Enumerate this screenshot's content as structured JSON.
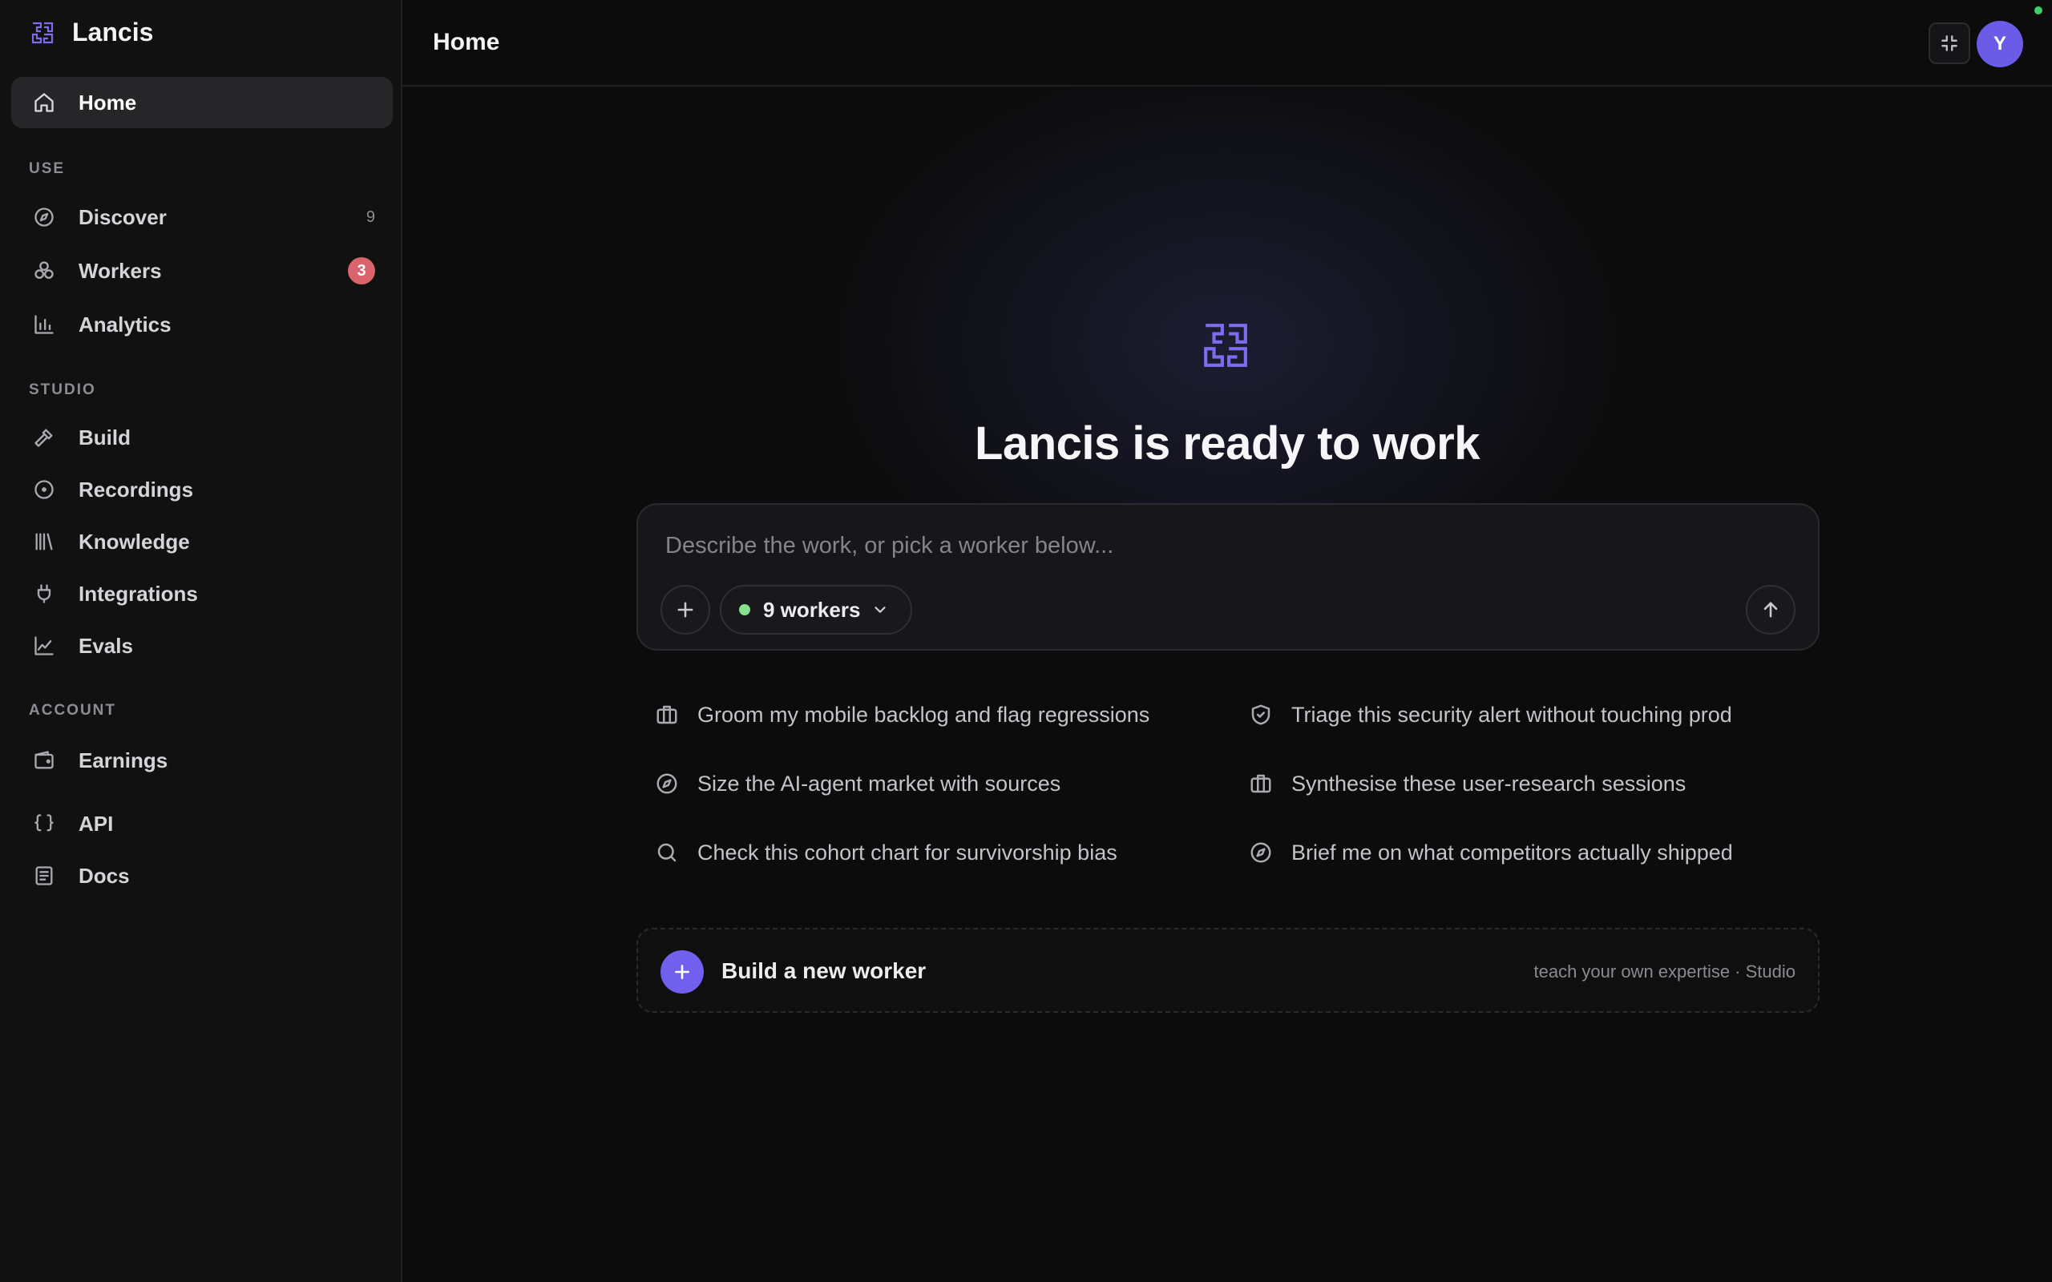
{
  "brand": {
    "name": "Lancis",
    "accent": "#7c6cf0"
  },
  "sidebar": {
    "home": {
      "label": "Home",
      "icon": "home-icon"
    },
    "sections": {
      "use": "USE",
      "studio": "STUDIO",
      "account": "ACCOUNT"
    },
    "use_items": [
      {
        "label": "Discover",
        "icon": "compass-icon",
        "count": "9"
      },
      {
        "label": "Workers",
        "icon": "workers-icon",
        "badge": "3"
      },
      {
        "label": "Analytics",
        "icon": "bar-chart-icon"
      }
    ],
    "studio_items": [
      {
        "label": "Build",
        "icon": "hammer-icon"
      },
      {
        "label": "Recordings",
        "icon": "record-icon"
      },
      {
        "label": "Knowledge",
        "icon": "library-icon"
      },
      {
        "label": "Integrations",
        "icon": "plug-icon"
      },
      {
        "label": "Evals",
        "icon": "line-chart-icon"
      }
    ],
    "account_items": [
      {
        "label": "Earnings",
        "icon": "wallet-icon"
      },
      {
        "label": "API",
        "icon": "braces-icon"
      },
      {
        "label": "Docs",
        "icon": "book-icon"
      }
    ]
  },
  "header": {
    "title": "Home",
    "avatar_initial": "Y"
  },
  "main": {
    "hero_title": "Lancis is ready to work",
    "composer": {
      "placeholder": "Describe the work, or pick a worker below...",
      "workers_label": "9 workers"
    },
    "suggestions": [
      {
        "text": "Groom my mobile backlog and flag regressions",
        "icon": "briefcase-icon"
      },
      {
        "text": "Triage this security alert without touching prod",
        "icon": "shield-check-icon"
      },
      {
        "text": "Size the AI-agent market with sources",
        "icon": "compass-icon"
      },
      {
        "text": "Synthesise these user-research sessions",
        "icon": "briefcase-icon"
      },
      {
        "text": "Check this cohort chart for survivorship bias",
        "icon": "search-icon"
      },
      {
        "text": "Brief me on what competitors actually shipped",
        "icon": "compass-icon"
      }
    ],
    "build_card": {
      "label": "Build a new worker",
      "subtitle": "teach your own expertise · Studio"
    }
  }
}
